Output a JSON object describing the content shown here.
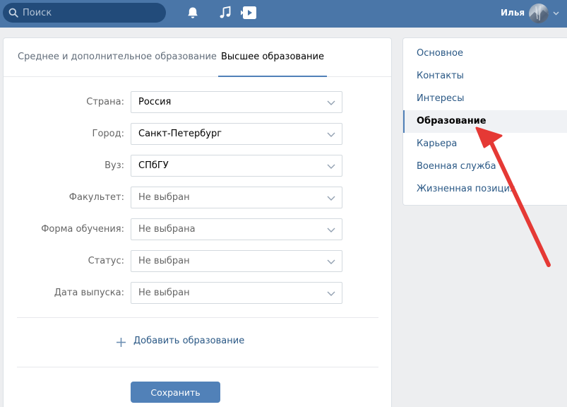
{
  "header": {
    "search_placeholder": "Поиск",
    "user_name": "Илья",
    "icons": [
      "search-icon",
      "bell-icon",
      "music-icon",
      "video-icon",
      "chevron-down-icon"
    ]
  },
  "tabs": [
    {
      "label": "Среднее и дополнительное образование",
      "active": false
    },
    {
      "label": "Высшее образование",
      "active": true
    }
  ],
  "form": {
    "fields": [
      {
        "label": "Страна:",
        "value": "Россия",
        "is_placeholder": false
      },
      {
        "label": "Город:",
        "value": "Санкт-Петербург",
        "is_placeholder": false
      },
      {
        "label": "Вуз:",
        "value": "СПбГУ",
        "is_placeholder": false
      },
      {
        "label": "Факультет:",
        "value": "Не выбран",
        "is_placeholder": true
      },
      {
        "label": "Форма обучения:",
        "value": "Не выбрана",
        "is_placeholder": true
      },
      {
        "label": "Статус:",
        "value": "Не выбран",
        "is_placeholder": true
      },
      {
        "label": "Дата выпуска:",
        "value": "Не выбран",
        "is_placeholder": true
      }
    ],
    "add_education_label": "Добавить образование",
    "save_label": "Сохранить"
  },
  "side_nav": {
    "items": [
      {
        "label": "Основное",
        "active": false
      },
      {
        "label": "Контакты",
        "active": false
      },
      {
        "label": "Интересы",
        "active": false
      },
      {
        "label": "Образование",
        "active": true
      },
      {
        "label": "Карьера",
        "active": false
      },
      {
        "label": "Военная служба",
        "active": false
      },
      {
        "label": "Жизненная позиция",
        "active": false
      }
    ]
  },
  "colors": {
    "header_bg": "#4a76a8",
    "accent": "#5181b8",
    "link": "#2a5885",
    "annotation_arrow": "#e53935"
  }
}
